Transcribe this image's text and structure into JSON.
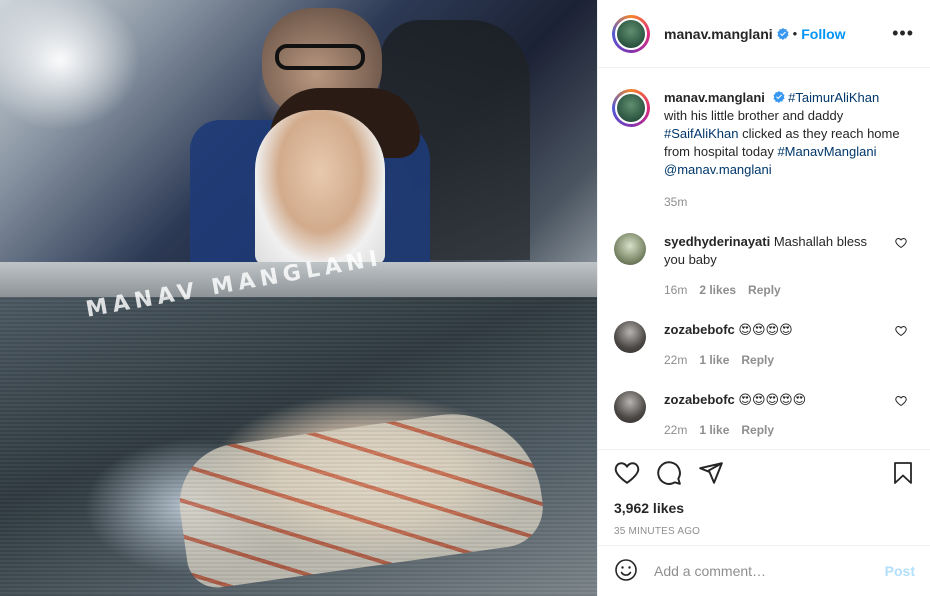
{
  "post": {
    "watermark": "MANAV MANGLANI"
  },
  "header": {
    "username": "manav.manglani",
    "separator": "•",
    "follow_label": "Follow",
    "more_label": "•••"
  },
  "caption": {
    "username": "manav.manglani",
    "tag1": "#TaimurAliKhan",
    "text1": " with his little brother and daddy ",
    "tag2": "#SaifAliKhan",
    "text2": " clicked as they reach home from hospital today ",
    "tag3": "#ManavManglani",
    "text3": " ",
    "tag4": "@manav.manglani",
    "time": "35m"
  },
  "comments": [
    {
      "username": "syedhyderinayati",
      "text": "Mashallah bless you baby",
      "time": "16m",
      "likes": "2 likes",
      "reply": "Reply"
    },
    {
      "username": "zozabebofc",
      "text": "😍😍😍😍",
      "time": "22m",
      "likes": "1 like",
      "reply": "Reply"
    },
    {
      "username": "zozabebofc",
      "text": "😍😍😍😍😍",
      "time": "22m",
      "likes": "1 like",
      "reply": "Reply"
    }
  ],
  "actions": {
    "icons": [
      "heart-icon",
      "comment-icon",
      "share-icon",
      "bookmark-icon"
    ],
    "likes_count": "3,962 likes",
    "posted": "35 MINUTES AGO"
  },
  "add_comment": {
    "placeholder": "Add a comment…",
    "post_label": "Post"
  },
  "colors": {
    "link": "#00376b",
    "follow": "#0095f6",
    "post_disabled": "#b2dffc",
    "verified": "#3897f0",
    "muted": "#8e8e8e"
  }
}
